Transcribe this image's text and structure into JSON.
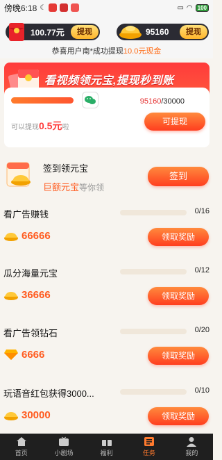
{
  "status_bar": {
    "time": "傍晚6:18",
    "battery": "100"
  },
  "balance": {
    "money": "100.77元",
    "money_btn": "提现",
    "coins": "95160",
    "coins_btn": "提现"
  },
  "notice": {
    "prefix": "恭喜用户南*成功提现",
    "amount": "10.0元现金"
  },
  "banner": {
    "title": "看视频领元宝,提现秒到账",
    "current": "95160",
    "total": "/30000",
    "can_prefix": "可以提现",
    "can_amount": "0.5元",
    "can_suffix": "啦",
    "btn": "可提现"
  },
  "signin": {
    "title": "签到领元宝",
    "sub_highlight": "巨额元宝",
    "sub_rest": "等你领",
    "btn": "签到"
  },
  "tasks": [
    {
      "name": "看广告赚钱",
      "progress": "0/16",
      "reward": "66666",
      "icon": "ingot-icon",
      "btn": "领取奖励"
    },
    {
      "name": "瓜分海量元宝",
      "progress": "0/12",
      "reward": "36666",
      "icon": "ingot-icon",
      "btn": "领取奖励"
    },
    {
      "name": "看广告领钻石",
      "progress": "0/20",
      "reward": "6666",
      "icon": "diamond-icon",
      "btn": "领取奖励"
    },
    {
      "name": "玩语音红包获得3000...",
      "progress": "0/10",
      "reward": "30000",
      "icon": "ingot-icon",
      "btn": "领取奖励"
    }
  ],
  "tabbar": [
    {
      "label": "首页",
      "icon": "home-icon"
    },
    {
      "label": "小剧场",
      "icon": "theater-icon"
    },
    {
      "label": "福利",
      "icon": "gift-icon"
    },
    {
      "label": "任务",
      "icon": "task-icon",
      "active": true
    },
    {
      "label": "我的",
      "icon": "profile-icon"
    }
  ],
  "colors": {
    "accent": "#ff5a1e",
    "banner_red": "#ff3b3b",
    "dark_pill": "#2b2b33",
    "tabbar": "#1f1f1f"
  }
}
